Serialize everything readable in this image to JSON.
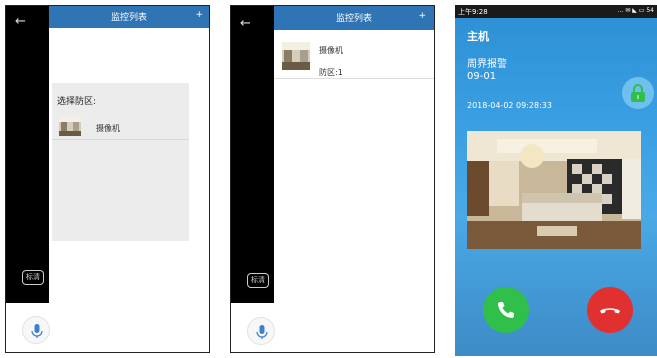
{
  "screen1": {
    "header": {
      "title": "监控列表",
      "plus": "+",
      "back": "←"
    },
    "popup": {
      "title": "选择防区:",
      "items": [
        {
          "label": "摄像机",
          "icon": "room-thumbnail"
        }
      ]
    },
    "quality_label": "标清"
  },
  "screen2": {
    "header": {
      "title": "监控列表",
      "plus": "+",
      "back": "←"
    },
    "camera": {
      "label": "摄像机",
      "zone": "防区:1"
    },
    "quality_label": "标清"
  },
  "screen3": {
    "status": {
      "time": "上午9:28",
      "icons": "... ✉ ◣ ▭ 54"
    },
    "host": "主机",
    "alarm_type": "周界报警",
    "alarm_code": "09-01",
    "datetime": "2018-04-02  09:28:33",
    "colors": {
      "answer": "#2fbf4a",
      "hangup": "#e0302f",
      "header": "#2f74b4"
    }
  }
}
